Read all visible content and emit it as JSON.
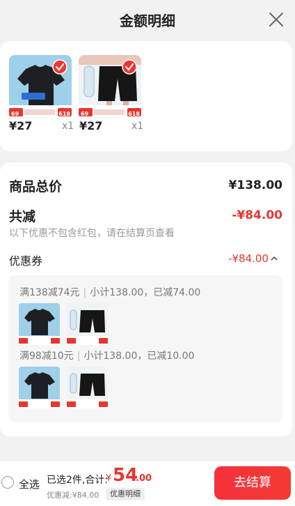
{
  "header": {
    "title": "金额明细"
  },
  "products": [
    {
      "price": "¥27",
      "qty": "x1",
      "badge_price": "69",
      "badge_sale": "618"
    },
    {
      "price": "¥27",
      "qty": "x1",
      "badge_price": "69",
      "badge_sale": "618"
    }
  ],
  "summary": {
    "total_label": "商品总价",
    "total_value": "¥138.00",
    "discount_label": "共减",
    "discount_value": "-¥84.00",
    "hint": "以下优惠不包含红包，请在结算页查看",
    "coupon_label": "优惠券",
    "coupon_value": "-¥84.00"
  },
  "coupons": [
    {
      "rule": "满138减74元",
      "subtotal": "小计138.00，已减74.00"
    },
    {
      "rule": "满98减10元",
      "subtotal": "小计138.00，已减10.00"
    }
  ],
  "footer": {
    "select_all": "全选",
    "selected_info": "已选2件,合计:",
    "yen": "¥",
    "total_int": "54",
    "total_dec": ".00",
    "discount_line": "优惠减:¥84.00",
    "detail_tag": "优惠明细",
    "checkout": "去结算"
  },
  "colors": {
    "accent": "#e6362f",
    "checkout": "#f5313b"
  }
}
